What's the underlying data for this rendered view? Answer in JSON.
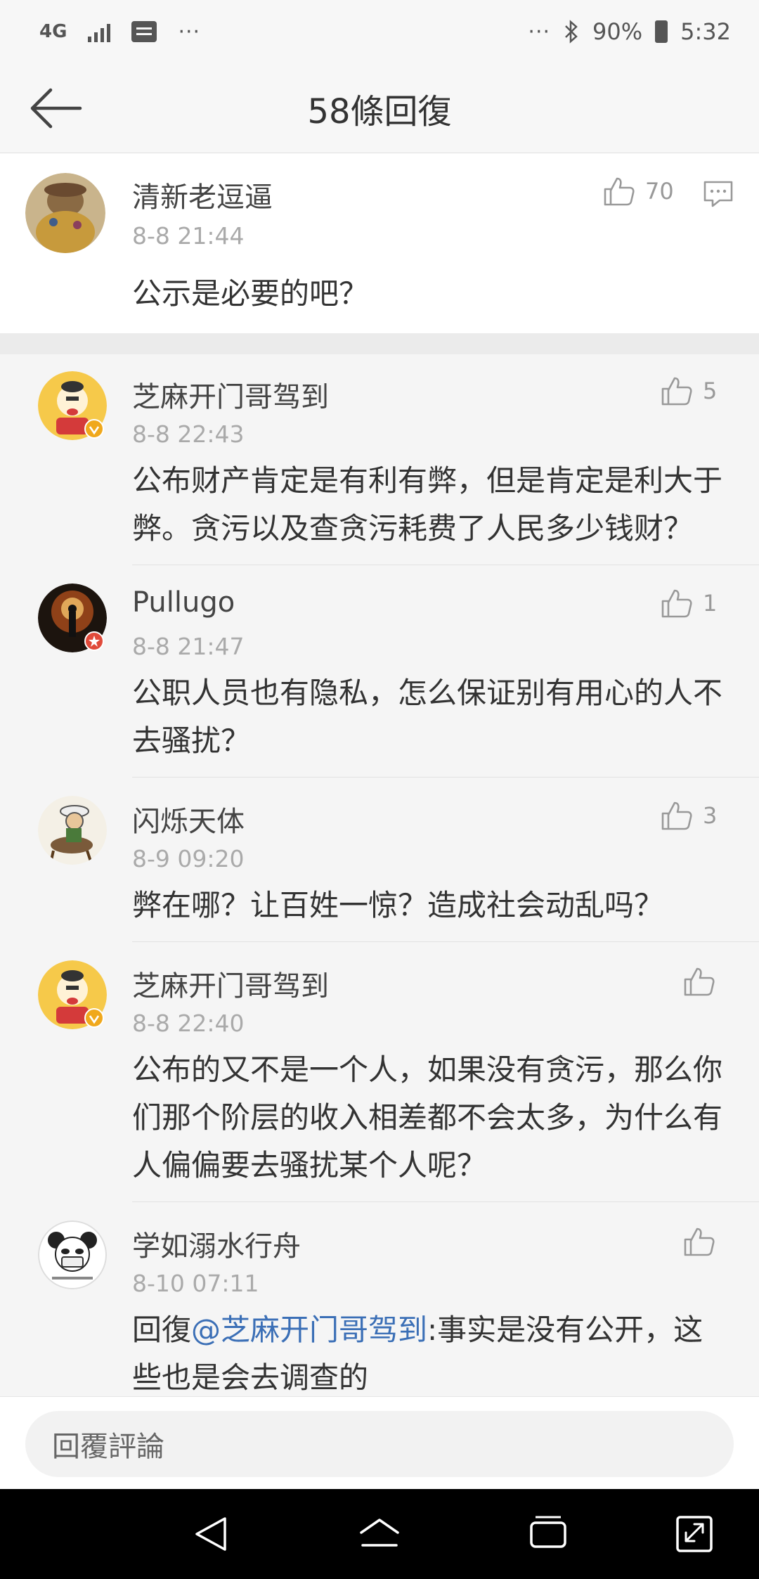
{
  "status": {
    "network": "4G",
    "battery": "90%",
    "time": "5:32",
    "left_dots": "···",
    "right_dots": "···"
  },
  "header": {
    "title": "58條回復"
  },
  "main_comment": {
    "user": "清新老逗逼",
    "time": "8-8 21:44",
    "likes": "70",
    "text": "公示是必要的吧？"
  },
  "replies": [
    {
      "user": "芝麻开门哥驾到",
      "time": "8-8 22:43",
      "likes": "5",
      "lines": [
        "公布财产肯定是有利有弊，但是肯定是利大于",
        "弊。贪污以及查贪污耗费了人民多少钱财？"
      ]
    },
    {
      "user": "Pullugo",
      "time": "8-8 21:47",
      "likes": "1",
      "lines": [
        "公职人员也有隐私，怎么保证别有用心的人不",
        "去骚扰？"
      ]
    },
    {
      "user": "闪烁天体",
      "time": "8-9 09:20",
      "likes": "3",
      "lines": [
        "弊在哪？让百姓一惊？造成社会动乱吗？"
      ]
    },
    {
      "user": "芝麻开门哥驾到",
      "time": "8-8 22:40",
      "likes": "",
      "lines": [
        "公布的又不是一个人，如果没有贪污，那么你",
        "们那个阶层的收入相差都不会太多，为什么有",
        "人偏偏要去骚扰某个人呢？"
      ]
    },
    {
      "user": "学如溺水行舟",
      "time": "8-10 07:11",
      "likes": "",
      "reply_prefix": "回復",
      "mention": "@芝麻开门哥驾到",
      "line1_rest": ":事实是没有公开，这",
      "line2": "些也是会去调查的"
    }
  ],
  "input": {
    "placeholder": "回覆評論"
  }
}
